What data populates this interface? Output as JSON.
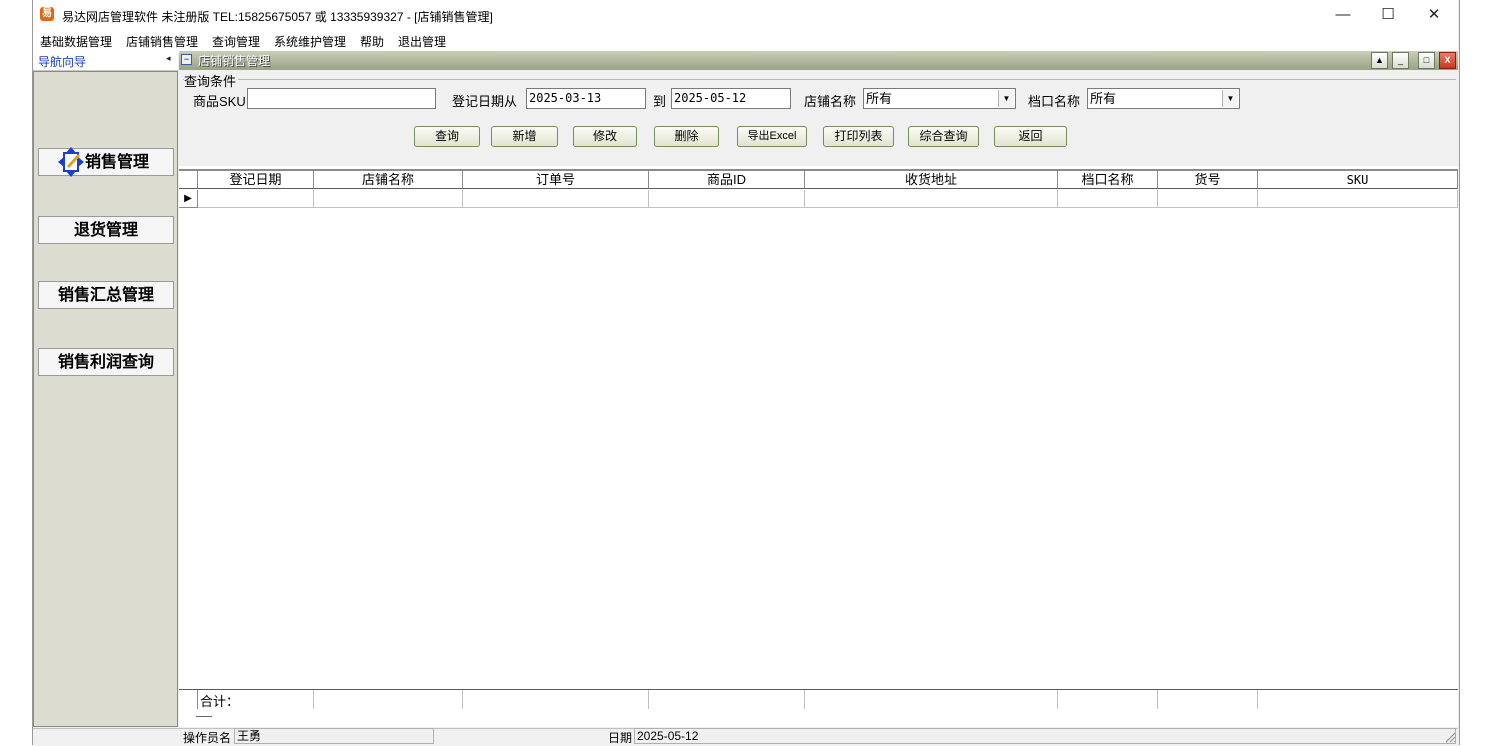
{
  "window": {
    "title": "易达网店管理软件  未注册版 TEL:15825675057 或 13335939327  - [店铺销售管理]",
    "icon_label": "易",
    "controls": {
      "minimize": "—",
      "maximize": "☐",
      "close": "✕"
    }
  },
  "menu": [
    "基础数据管理",
    "店铺销售管理",
    "查询管理",
    "系统维护管理",
    "帮助",
    "退出管理"
  ],
  "nav": {
    "title": "导航向导",
    "collapse": "◂",
    "items": [
      "销售管理",
      "退货管理",
      "销售汇总管理",
      "销售利润查询"
    ]
  },
  "child": {
    "title": "店铺销售管理",
    "controls": {
      "up": "▲",
      "min": "_",
      "max": "□",
      "close": "X"
    }
  },
  "query": {
    "group_title": "查询条件",
    "sku_label": "商品SKU",
    "sku_value": "",
    "date_from_label": "登记日期从",
    "date_from": "2025-03-13",
    "date_to_label": "到",
    "date_to": "2025-05-12",
    "shop_label": "店铺名称",
    "shop_value": "所有",
    "stall_label": "档口名称",
    "stall_value": "所有",
    "buttons": [
      "查询",
      "新增",
      "修改",
      "删除",
      "导出Excel",
      "打印列表",
      "综合查询",
      "返回"
    ]
  },
  "grid": {
    "columns": [
      "登记日期",
      "店铺名称",
      "订单号",
      "商品ID",
      "收货地址",
      "档口名称",
      "货号",
      "SKU"
    ],
    "row_indicator": "▶",
    "total_label": "合计："
  },
  "status": {
    "operator_label": "操作员名",
    "operator": "王勇",
    "date_label": "日期",
    "date": "2025-05-12"
  }
}
